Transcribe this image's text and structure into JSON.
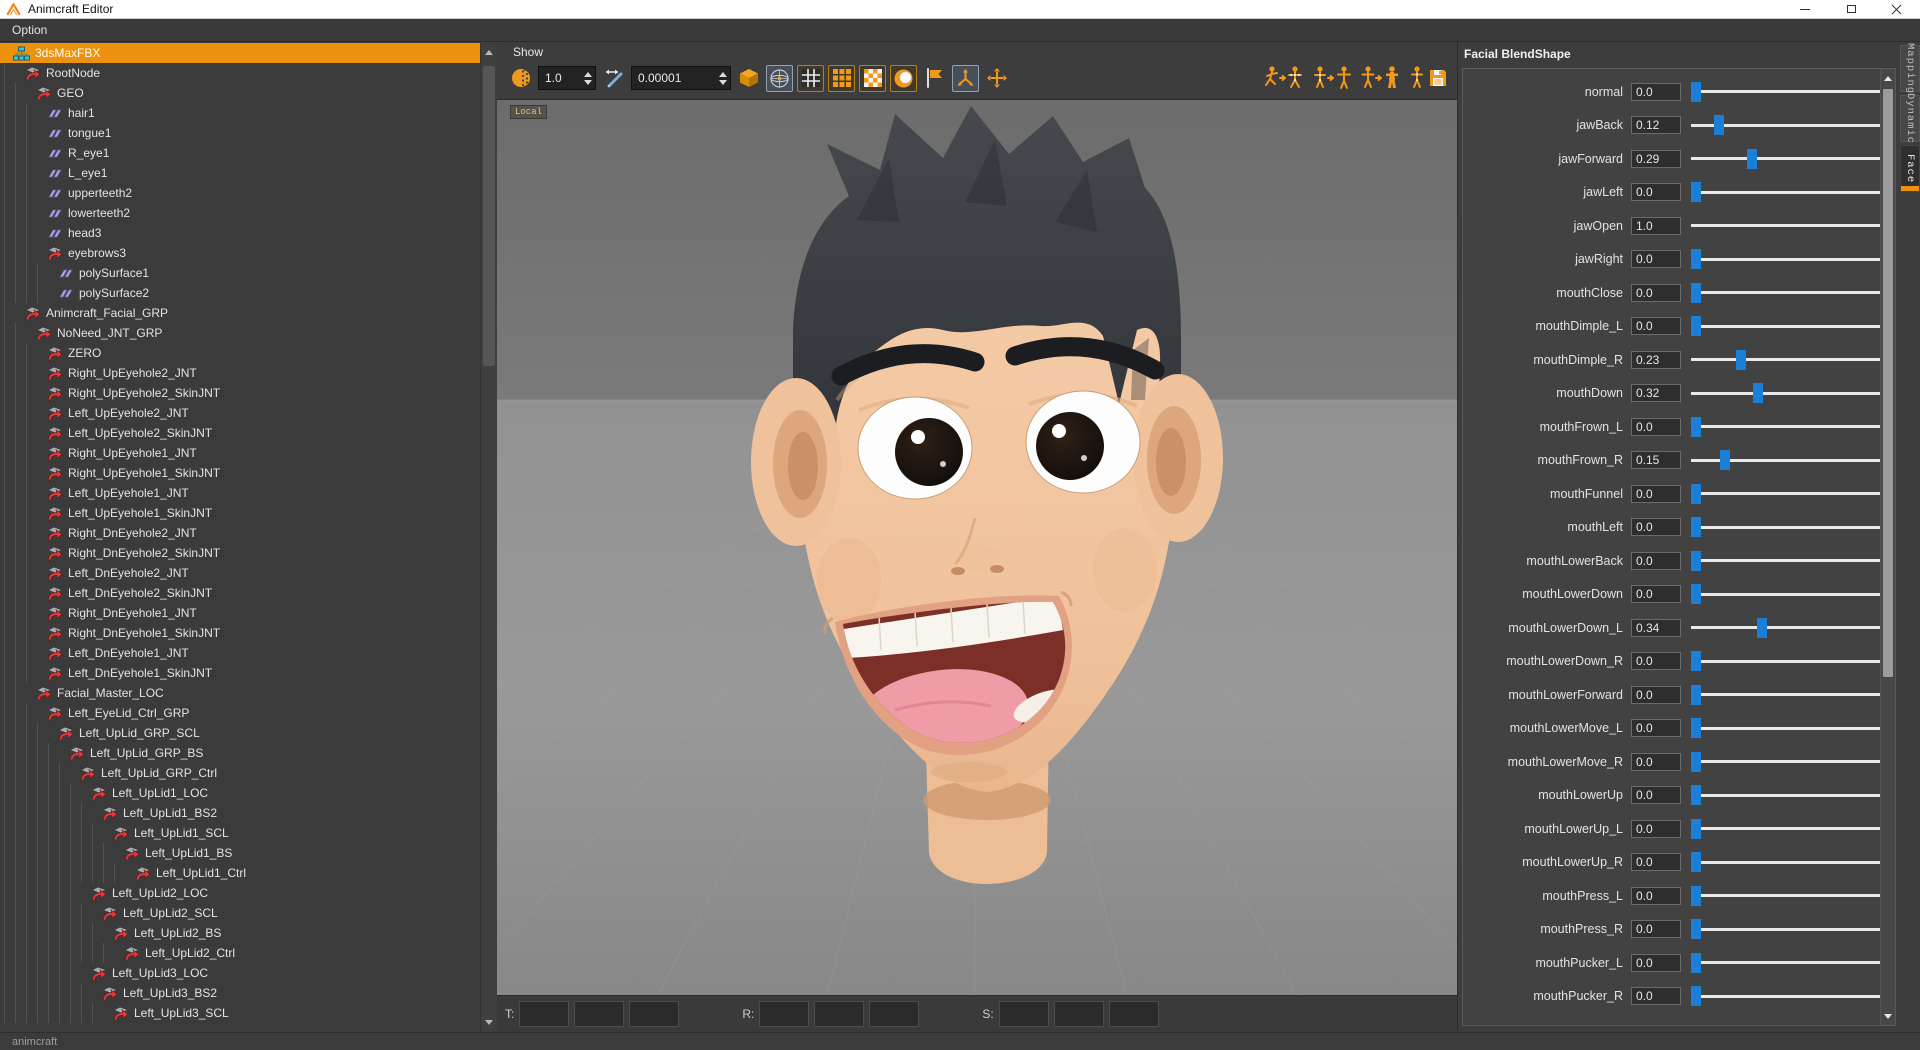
{
  "titlebar": {
    "title": "Animcraft Editor"
  },
  "menubar": {
    "items": [
      {
        "label": "Option"
      }
    ]
  },
  "scene_tree": {
    "items": [
      {
        "l": "3dsMaxFBX",
        "d": 0,
        "i": "scene",
        "e": true,
        "s": true
      },
      {
        "l": "RootNode",
        "d": 1,
        "i": "transform",
        "e": true,
        "s": false
      },
      {
        "l": "GEO",
        "d": 2,
        "i": "transform",
        "e": true,
        "s": false
      },
      {
        "l": "hair1",
        "d": 3,
        "i": "mesh",
        "e": false,
        "s": false
      },
      {
        "l": "tongue1",
        "d": 3,
        "i": "mesh",
        "e": false,
        "s": false
      },
      {
        "l": "R_eye1",
        "d": 3,
        "i": "mesh",
        "e": false,
        "s": false
      },
      {
        "l": "L_eye1",
        "d": 3,
        "i": "mesh",
        "e": false,
        "s": false
      },
      {
        "l": "upperteeth2",
        "d": 3,
        "i": "mesh",
        "e": false,
        "s": false
      },
      {
        "l": "lowerteeth2",
        "d": 3,
        "i": "mesh",
        "e": false,
        "s": false
      },
      {
        "l": "head3",
        "d": 3,
        "i": "mesh",
        "e": false,
        "s": false
      },
      {
        "l": "eyebrows3",
        "d": 3,
        "i": "transform",
        "e": true,
        "s": false
      },
      {
        "l": "polySurface1",
        "d": 4,
        "i": "mesh",
        "e": false,
        "s": false
      },
      {
        "l": "polySurface2",
        "d": 4,
        "i": "mesh",
        "e": false,
        "s": false
      },
      {
        "l": "Animcraft_Facial_GRP",
        "d": 1,
        "i": "transform",
        "e": true,
        "s": false
      },
      {
        "l": "NoNeed_JNT_GRP",
        "d": 2,
        "i": "transform",
        "e": true,
        "s": false
      },
      {
        "l": "ZERO",
        "d": 3,
        "i": "transform",
        "e": false,
        "s": false
      },
      {
        "l": "Right_UpEyehole2_JNT",
        "d": 3,
        "i": "transform",
        "e": false,
        "s": false
      },
      {
        "l": "Right_UpEyehole2_SkinJNT",
        "d": 3,
        "i": "transform",
        "e": false,
        "s": false
      },
      {
        "l": "Left_UpEyehole2_JNT",
        "d": 3,
        "i": "transform",
        "e": false,
        "s": false
      },
      {
        "l": "Left_UpEyehole2_SkinJNT",
        "d": 3,
        "i": "transform",
        "e": false,
        "s": false
      },
      {
        "l": "Right_UpEyehole1_JNT",
        "d": 3,
        "i": "transform",
        "e": false,
        "s": false
      },
      {
        "l": "Right_UpEyehole1_SkinJNT",
        "d": 3,
        "i": "transform",
        "e": false,
        "s": false
      },
      {
        "l": "Left_UpEyehole1_JNT",
        "d": 3,
        "i": "transform",
        "e": false,
        "s": false
      },
      {
        "l": "Left_UpEyehole1_SkinJNT",
        "d": 3,
        "i": "transform",
        "e": false,
        "s": false
      },
      {
        "l": "Right_DnEyehole2_JNT",
        "d": 3,
        "i": "transform",
        "e": false,
        "s": false
      },
      {
        "l": "Right_DnEyehole2_SkinJNT",
        "d": 3,
        "i": "transform",
        "e": false,
        "s": false
      },
      {
        "l": "Left_DnEyehole2_JNT",
        "d": 3,
        "i": "transform",
        "e": false,
        "s": false
      },
      {
        "l": "Left_DnEyehole2_SkinJNT",
        "d": 3,
        "i": "transform",
        "e": false,
        "s": false
      },
      {
        "l": "Right_DnEyehole1_JNT",
        "d": 3,
        "i": "transform",
        "e": false,
        "s": false
      },
      {
        "l": "Right_DnEyehole1_SkinJNT",
        "d": 3,
        "i": "transform",
        "e": false,
        "s": false
      },
      {
        "l": "Left_DnEyehole1_JNT",
        "d": 3,
        "i": "transform",
        "e": false,
        "s": false
      },
      {
        "l": "Left_DnEyehole1_SkinJNT",
        "d": 3,
        "i": "transform",
        "e": false,
        "s": false
      },
      {
        "l": "Facial_Master_LOC",
        "d": 2,
        "i": "transform",
        "e": true,
        "s": false
      },
      {
        "l": "Left_EyeLid_Ctrl_GRP",
        "d": 3,
        "i": "transform",
        "e": true,
        "s": false
      },
      {
        "l": "Left_UpLid_GRP_SCL",
        "d": 4,
        "i": "transform",
        "e": true,
        "s": false
      },
      {
        "l": "Left_UpLid_GRP_BS",
        "d": 5,
        "i": "transform",
        "e": true,
        "s": false
      },
      {
        "l": "Left_UpLid_GRP_Ctrl",
        "d": 6,
        "i": "transform",
        "e": true,
        "s": false
      },
      {
        "l": "Left_UpLid1_LOC",
        "d": 7,
        "i": "transform",
        "e": true,
        "s": false
      },
      {
        "l": "Left_UpLid1_BS2",
        "d": 8,
        "i": "transform",
        "e": true,
        "s": false
      },
      {
        "l": "Left_UpLid1_SCL",
        "d": 9,
        "i": "transform",
        "e": true,
        "s": false
      },
      {
        "l": "Left_UpLid1_BS",
        "d": 10,
        "i": "transform",
        "e": true,
        "s": false
      },
      {
        "l": "Left_UpLid1_Ctrl",
        "d": 11,
        "i": "transform",
        "e": false,
        "s": false
      },
      {
        "l": "Left_UpLid2_LOC",
        "d": 7,
        "i": "transform",
        "e": true,
        "s": false
      },
      {
        "l": "Left_UpLid2_SCL",
        "d": 8,
        "i": "transform",
        "e": true,
        "s": false
      },
      {
        "l": "Left_UpLid2_BS",
        "d": 9,
        "i": "transform",
        "e": true,
        "s": false
      },
      {
        "l": "Left_UpLid2_Ctrl",
        "d": 10,
        "i": "transform",
        "e": false,
        "s": false
      },
      {
        "l": "Left_UpLid3_LOC",
        "d": 7,
        "i": "transform",
        "e": true,
        "s": false
      },
      {
        "l": "Left_UpLid3_BS2",
        "d": 8,
        "i": "transform",
        "e": true,
        "s": false
      },
      {
        "l": "Left_UpLid3_SCL",
        "d": 9,
        "i": "transform",
        "e": true,
        "s": false
      }
    ]
  },
  "viewport_toolbar": {
    "show_label": "Show",
    "display_value": "1.0",
    "precision_value": "0.00001"
  },
  "viewport": {
    "coordinate_badge": "Local"
  },
  "transform_bar": {
    "t_label": "T:",
    "r_label": "R:",
    "s_label": "S:",
    "t_values": [
      "",
      "",
      ""
    ],
    "r_values": [
      "",
      "",
      ""
    ],
    "s_values": [
      "",
      "",
      ""
    ]
  },
  "blendshape": {
    "title": "Facial BlendShape",
    "sliders": [
      {
        "label": "normal",
        "display": "0.0",
        "value": 0
      },
      {
        "label": "jawBack",
        "display": "0.12",
        "value": 0.12
      },
      {
        "label": "jawForward",
        "display": "0.29",
        "value": 0.29
      },
      {
        "label": "jawLeft",
        "display": "0.0",
        "value": 0
      },
      {
        "label": "jawOpen",
        "display": "1.0",
        "value": 1
      },
      {
        "label": "jawRight",
        "display": "0.0",
        "value": 0
      },
      {
        "label": "mouthClose",
        "display": "0.0",
        "value": 0
      },
      {
        "label": "mouthDimple_L",
        "display": "0.0",
        "value": 0
      },
      {
        "label": "mouthDimple_R",
        "display": "0.23",
        "value": 0.23
      },
      {
        "label": "mouthDown",
        "display": "0.32",
        "value": 0.32
      },
      {
        "label": "mouthFrown_L",
        "display": "0.0",
        "value": 0
      },
      {
        "label": "mouthFrown_R",
        "display": "0.15",
        "value": 0.15
      },
      {
        "label": "mouthFunnel",
        "display": "0.0",
        "value": 0
      },
      {
        "label": "mouthLeft",
        "display": "0.0",
        "value": 0
      },
      {
        "label": "mouthLowerBack",
        "display": "0.0",
        "value": 0
      },
      {
        "label": "mouthLowerDown",
        "display": "0.0",
        "value": 0
      },
      {
        "label": "mouthLowerDown_L",
        "display": "0.34",
        "value": 0.34
      },
      {
        "label": "mouthLowerDown_R",
        "display": "0.0",
        "value": 0
      },
      {
        "label": "mouthLowerForward",
        "display": "0.0",
        "value": 0
      },
      {
        "label": "mouthLowerMove_L",
        "display": "0.0",
        "value": 0
      },
      {
        "label": "mouthLowerMove_R",
        "display": "0.0",
        "value": 0
      },
      {
        "label": "mouthLowerUp",
        "display": "0.0",
        "value": 0
      },
      {
        "label": "mouthLowerUp_L",
        "display": "0.0",
        "value": 0
      },
      {
        "label": "mouthLowerUp_R",
        "display": "0.0",
        "value": 0
      },
      {
        "label": "mouthPress_L",
        "display": "0.0",
        "value": 0
      },
      {
        "label": "mouthPress_R",
        "display": "0.0",
        "value": 0
      },
      {
        "label": "mouthPucker_L",
        "display": "0.0",
        "value": 0
      },
      {
        "label": "mouthPucker_R",
        "display": "0.0",
        "value": 0
      }
    ]
  },
  "side_tabs": {
    "tabs": [
      {
        "label": "Mapping",
        "active": false
      },
      {
        "label": "Dynamic",
        "active": false
      },
      {
        "label": "Face",
        "active": true
      }
    ]
  },
  "statusbar": {
    "text": "animcraft"
  },
  "colors": {
    "accent": "#ED920F",
    "slider_handle": "#1B7FD8",
    "selection_orange": "#ED920F"
  }
}
